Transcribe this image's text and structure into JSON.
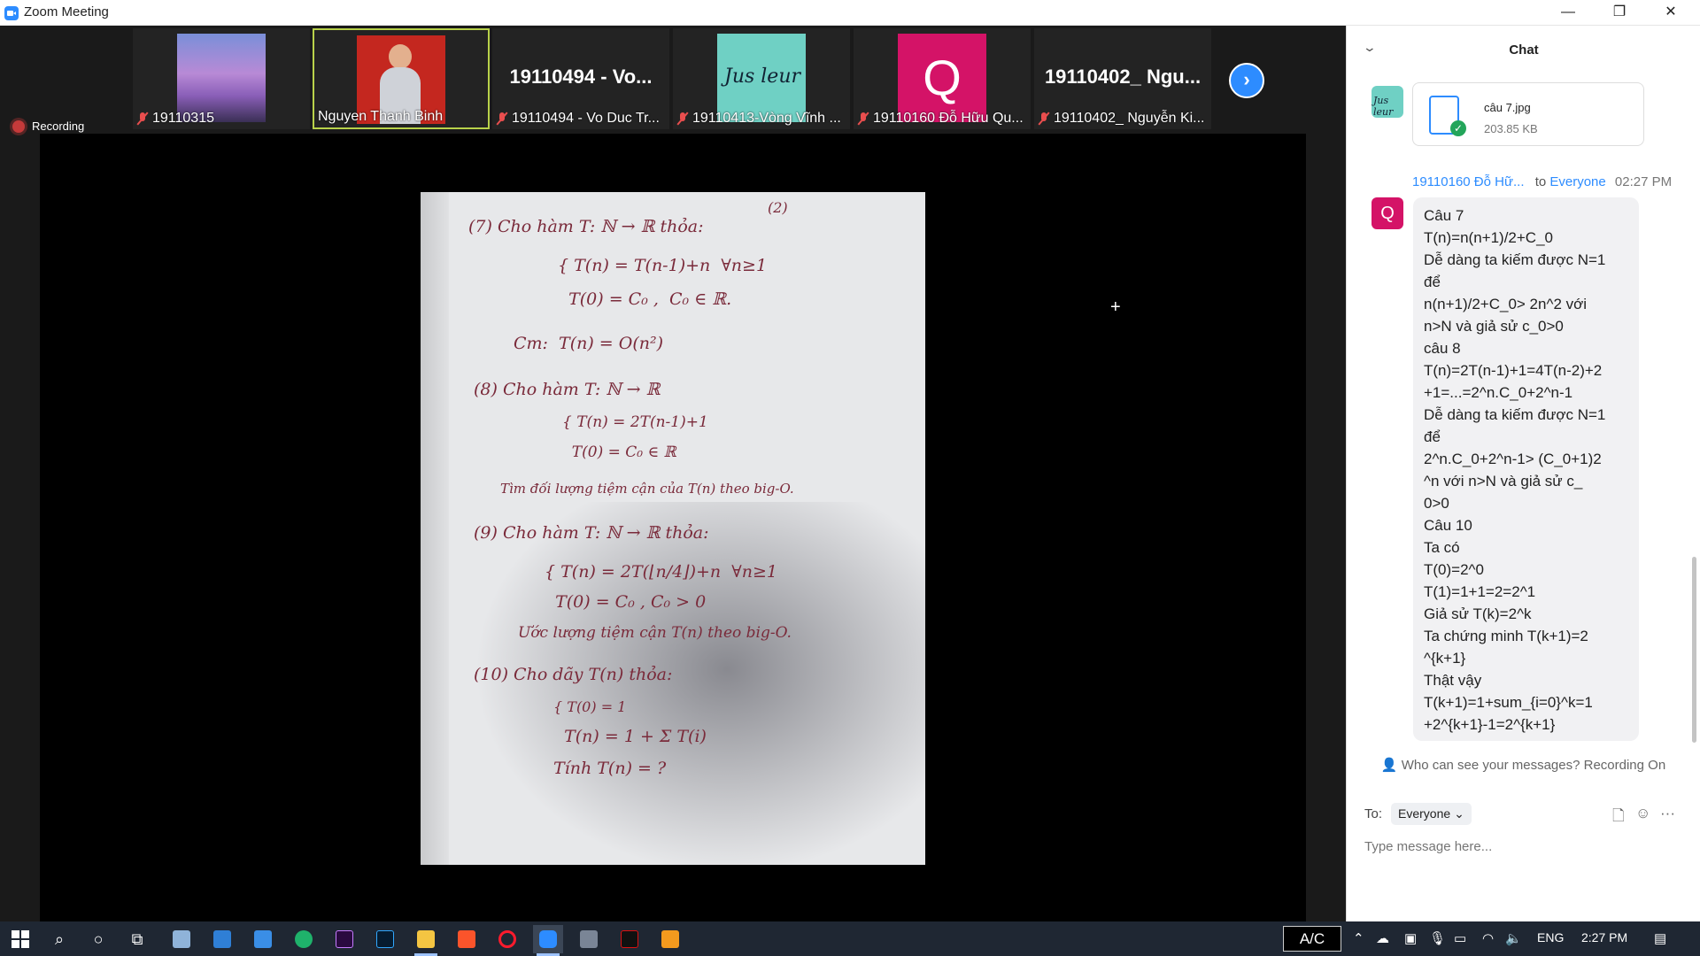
{
  "window": {
    "title": "Zoom Meeting",
    "minimize": "—",
    "restore": "❐",
    "close": "✕"
  },
  "participants": [
    {
      "label": "19110315",
      "muted": true,
      "image": "purple-tree",
      "active": false
    },
    {
      "label": "Nguyen Thanh Binh",
      "muted": false,
      "image": "person-red-background",
      "active": true
    },
    {
      "label": "19110494 - Vo Duc Tr...",
      "name_display": "19110494 - Vo...",
      "muted": true,
      "image": "",
      "active": false
    },
    {
      "label": "19110413-Vòng Vĩnh ...",
      "muted": true,
      "image": "signature-teal",
      "active": false
    },
    {
      "label": "19110160 Đỗ Hữu Qu...",
      "muted": true,
      "image": "letter-q-pink",
      "active": false
    },
    {
      "label": "19110402_ Nguyễn Ki...",
      "name_display": "19110402_ Ngu...",
      "muted": true,
      "image": "",
      "active": false
    }
  ],
  "next_page_icon": "chevron-right-icon",
  "recording_label": "Recording",
  "shared_content": {
    "description_lines": [
      "(7) Cho hàm T: ℕ → ℝ thỏa:",
      "{ T(n) = T(n-1)+n  ∀n≥1",
      "  T(0) = C₀ ,  C₀ ∈ ℝ.",
      "Cm:  T(n) = O(n²)",
      "(8) Cho hàm T: ℕ → ℝ",
      "{ T(n) = 2T(n-1)+1",
      "  T(0) = C₀ ∈ ℝ",
      "Tìm đối lượng tiệm cận của T(n) theo big-O.",
      "(9) Cho hàm T: ℕ → ℝ thỏa:",
      "{ T(n) = 2T(⌊n/4⌋)+n  ∀n≥1",
      "  T(0) = C₀ , C₀ > 0",
      "Ước lượng tiệm cận T(n) theo big-O.",
      "(10) Cho dãy T(n) thỏa:",
      "{ T(0) = 1",
      "  T(n) = 1 + Σ T(i)",
      "Tính T(n) = ?"
    ],
    "page_marker": "(2)"
  },
  "chat": {
    "title": "Chat",
    "collapse_icon": "chevron-down-icon",
    "file": {
      "name": "câu 7.jpg",
      "size": "203.85 KB"
    },
    "message": {
      "sender": "19110160 Đỗ Hữ...",
      "to_word": "to",
      "recipient": "Everyone",
      "time": "02:27 PM",
      "avatar_letter": "Q",
      "lines": [
        "Câu 7",
        "T(n)=n(n+1)/2+C_0",
        "Dễ dàng ta kiếm được N=1",
        "để",
        "n(n+1)/2+C_0> 2n^2 với",
        "n>N và giả sử c_0>0",
        "câu 8",
        "T(n)=2T(n-1)+1=4T(n-2)+2",
        "+1=...=2^n.C_0+2^n-1",
        "Dễ dàng ta kiếm được N=1",
        "để",
        "2^n.C_0+2^n-1> (C_0+1)2",
        "^n với n>N và giả sử c_",
        "0>0",
        "Câu 10",
        "Ta có",
        "T(0)=2^0",
        "T(1)=1+1=2=2^1",
        "Giả sử T(k)=2^k",
        "Ta chứng minh T(k+1)=2",
        "^{k+1}",
        "Thật vậy",
        "T(k+1)=1+sum_{i=0}^k=1",
        "+2^{k+1}-1=2^{k+1}"
      ]
    },
    "privacy_text": "Who can see your messages? Recording On",
    "to_label": "To:",
    "to_value": "Everyone",
    "input_placeholder": "Type message here..."
  },
  "taskbar": {
    "ac_label": "A/C",
    "language": "ENG",
    "time": "2:27 PM"
  },
  "colors": {
    "zoom_blue": "#2d8cff",
    "muted_red": "#e94e4e",
    "active_border": "#b8d14a",
    "avatar_pink": "#d41367"
  }
}
